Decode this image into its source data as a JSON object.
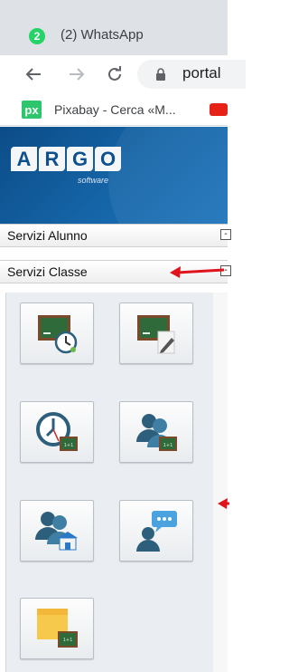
{
  "browser": {
    "tab": {
      "title": "(2) WhatsApp",
      "badge": "2"
    },
    "address": {
      "url_visible": "portal"
    },
    "bookmarks": [
      {
        "icon": "pixabay-icon",
        "badge_text": "px",
        "label": "Pixabay - Cerca «M..."
      },
      {
        "icon": "youtube-icon"
      }
    ]
  },
  "app": {
    "logo": {
      "letters": [
        "A",
        "R",
        "G",
        "O"
      ],
      "subtitle": "software"
    },
    "sections": [
      {
        "label": "Servizi Alunno",
        "toggle": "-"
      },
      {
        "label": "Servizi Classe",
        "toggle": "-"
      }
    ],
    "tiles": [
      {
        "icon": "blackboard-clock-icon"
      },
      {
        "icon": "blackboard-pencil-icon"
      },
      {
        "icon": "clock-blackboard-icon"
      },
      {
        "icon": "teachers-blackboard-icon"
      },
      {
        "icon": "people-school-icon"
      },
      {
        "icon": "person-chat-icon"
      },
      {
        "icon": "sticky-note-blackboard-icon"
      }
    ],
    "colors": {
      "header_blue": "#0c4c87",
      "annotation_red": "#e0141c",
      "blackboard_green": "#2f6b3a",
      "board_frame": "#7b4a2a"
    }
  }
}
